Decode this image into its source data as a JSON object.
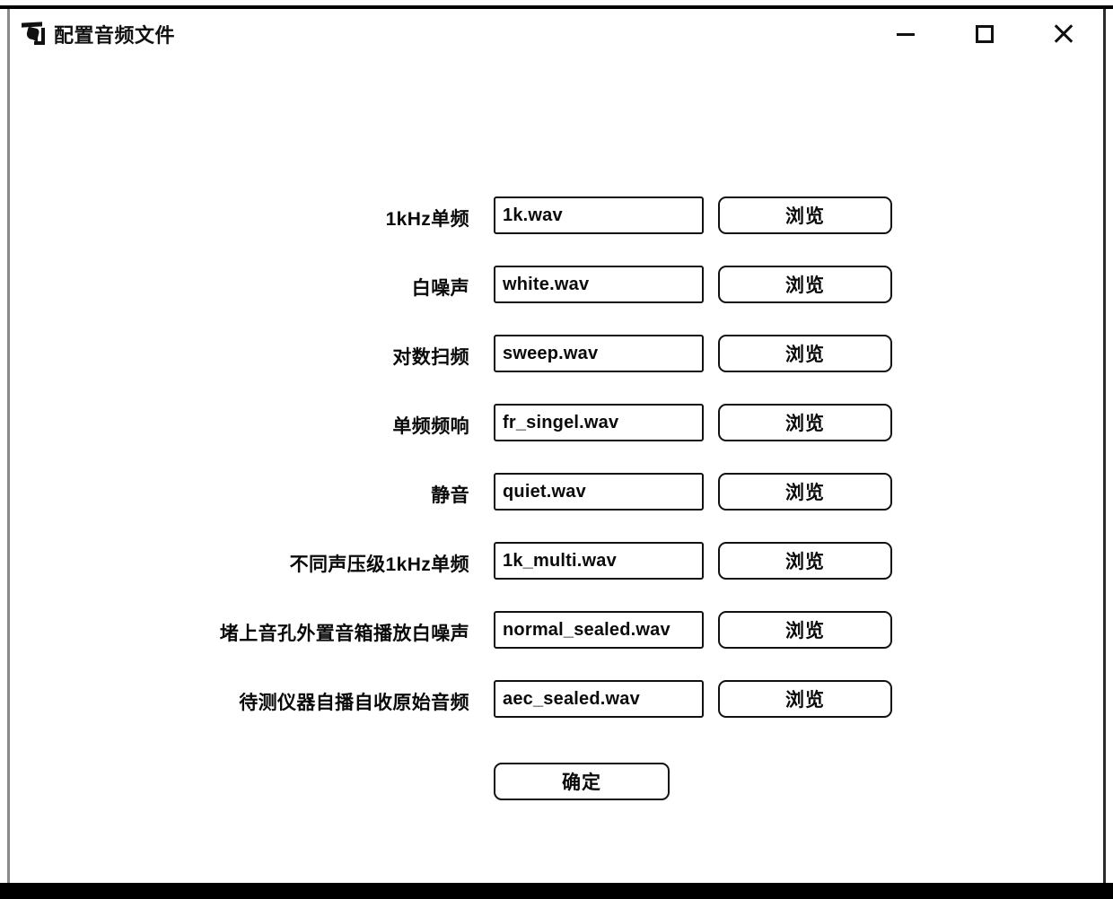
{
  "window": {
    "title": "配置音频文件",
    "app_icon": "audio-config-icon",
    "controls": {
      "minimize": "minimize-icon",
      "maximize": "maximize-icon",
      "close": "close-icon"
    }
  },
  "form": {
    "browse_label": "浏览",
    "rows": [
      {
        "label": "1kHz单频",
        "value": "1k.wav",
        "browse": "浏览"
      },
      {
        "label": "白噪声",
        "value": "white.wav",
        "browse": "浏览"
      },
      {
        "label": "对数扫频",
        "value": "sweep.wav",
        "browse": "浏览"
      },
      {
        "label": "单频频响",
        "value": "fr_singel.wav",
        "browse": "浏览"
      },
      {
        "label": "静音",
        "value": "quiet.wav",
        "browse": "浏览"
      },
      {
        "label": "不同声压级1kHz单频",
        "value": "1k_multi.wav",
        "browse": "浏览"
      },
      {
        "label": "堵上音孔外置音箱播放白噪声",
        "value": "normal_sealed.wav",
        "browse": "浏览"
      },
      {
        "label": "待测仪器自播自收原始音频",
        "value": "aec_sealed.wav",
        "browse": "浏览"
      }
    ]
  },
  "footer": {
    "confirm_label": "确定"
  },
  "colors": {
    "text": "#0a0a0a",
    "border": "#111111",
    "background": "#ffffff",
    "frame_left": "#8a8a8a",
    "frame_dark": "#000000"
  }
}
